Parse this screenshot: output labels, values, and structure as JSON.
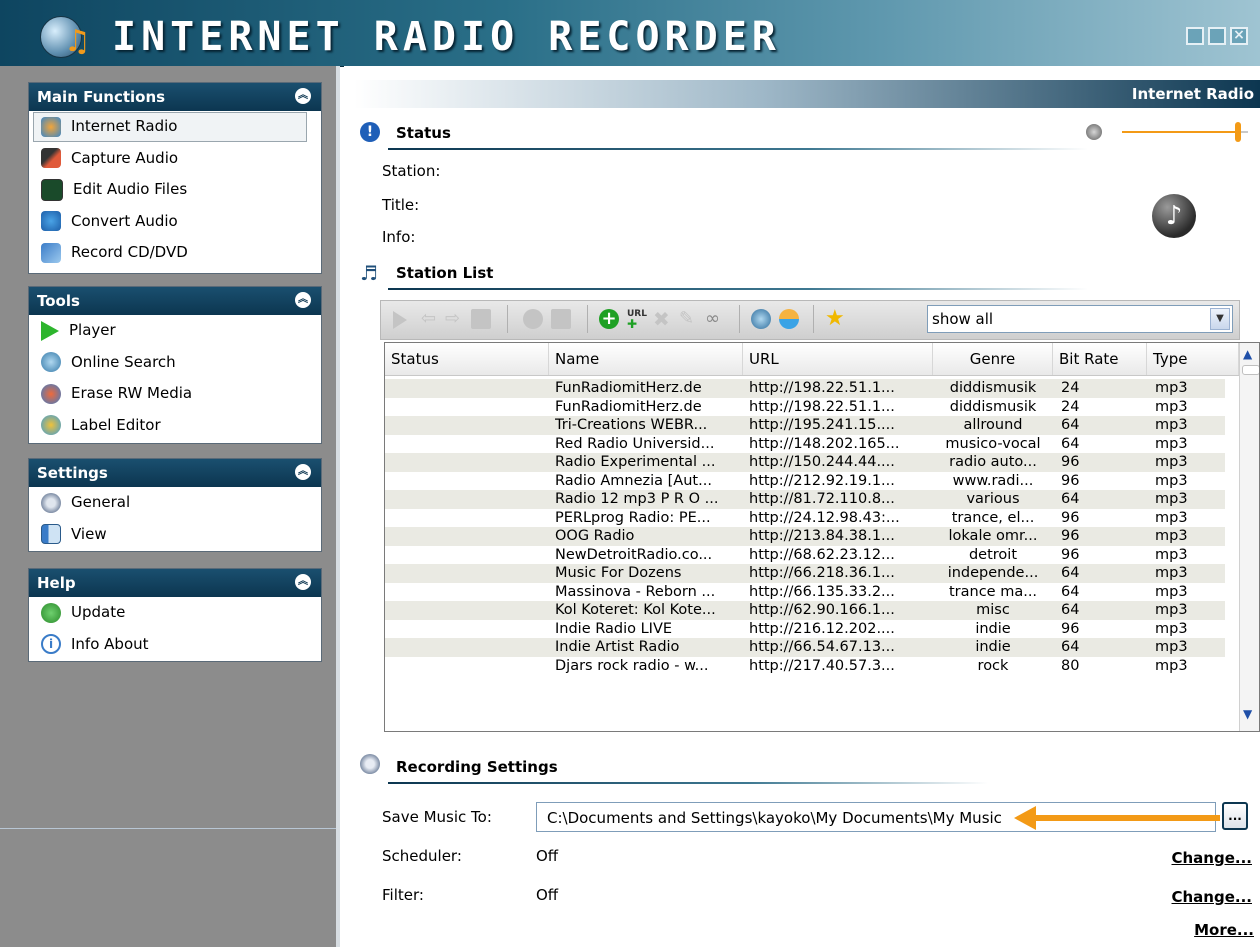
{
  "app": {
    "title": "INTERNET RADIO RECORDER"
  },
  "sidebar": {
    "main_functions": {
      "title": "Main Functions",
      "items": [
        {
          "label": "Internet Radio",
          "icon": "globe-note-icon",
          "active": true
        },
        {
          "label": "Capture Audio",
          "icon": "microphone-icon"
        },
        {
          "label": "Edit Audio Files",
          "icon": "waveform-icon"
        },
        {
          "label": "Convert Audio",
          "icon": "convert-note-icon"
        },
        {
          "label": "Record CD/DVD",
          "icon": "disc-burn-icon"
        }
      ]
    },
    "tools": {
      "title": "Tools",
      "items": [
        {
          "label": "Player",
          "icon": "play-icon"
        },
        {
          "label": "Online Search",
          "icon": "online-search-icon"
        },
        {
          "label": "Erase RW Media",
          "icon": "erase-disc-icon"
        },
        {
          "label": "Label Editor",
          "icon": "label-editor-icon"
        }
      ]
    },
    "settings": {
      "title": "Settings",
      "items": [
        {
          "label": "General",
          "icon": "gear-icon"
        },
        {
          "label": "View",
          "icon": "view-icon"
        }
      ]
    },
    "help": {
      "title": "Help",
      "items": [
        {
          "label": "Update",
          "icon": "update-icon"
        },
        {
          "label": "Info About",
          "icon": "info-icon"
        }
      ]
    }
  },
  "main": {
    "header": "Internet Radio",
    "status": {
      "title": "Status",
      "station_label": "Station:",
      "title_label": "Title:",
      "info_label": "Info:",
      "volume": 0.92
    },
    "station_list": {
      "title": "Station List",
      "filter_value": "show all",
      "columns": [
        "Status",
        "Name",
        "URL",
        "Genre",
        "Bit Rate",
        "Type"
      ],
      "rows": [
        [
          "",
          "FunRadiomitHerz.de",
          "http://198.22.51.1...",
          "diddismusik",
          "24",
          "mp3"
        ],
        [
          "",
          "FunRadiomitHerz.de",
          "http://198.22.51.1...",
          "diddismusik",
          "24",
          "mp3"
        ],
        [
          "",
          "Tri-Creations WEBR...",
          "http://195.241.15....",
          "allround",
          "64",
          "mp3"
        ],
        [
          "",
          "Red Radio Universid...",
          "http://148.202.165...",
          "musico-vocal",
          "64",
          "mp3"
        ],
        [
          "",
          "Radio Experimental ...",
          "http://150.244.44....",
          "radio auto...",
          "96",
          "mp3"
        ],
        [
          "",
          "Radio Amnezia [Aut...",
          "http://212.92.19.1...",
          "www.radi...",
          "96",
          "mp3"
        ],
        [
          "",
          "Radio 12 mp3 P R O ...",
          "http://81.72.110.8...",
          "various",
          "64",
          "mp3"
        ],
        [
          "",
          "PERLprog Radio: PE...",
          "http://24.12.98.43:...",
          "trance, el...",
          "96",
          "mp3"
        ],
        [
          "",
          "OOG Radio",
          "http://213.84.38.1...",
          "lokale omr...",
          "96",
          "mp3"
        ],
        [
          "",
          "NewDetroitRadio.co...",
          "http://68.62.23.12...",
          "detroit",
          "96",
          "mp3"
        ],
        [
          "",
          "Music For Dozens",
          "http://66.218.36.1...",
          "independe...",
          "64",
          "mp3"
        ],
        [
          "",
          "Massinova - Reborn ...",
          "http://66.135.33.2...",
          "trance ma...",
          "64",
          "mp3"
        ],
        [
          "",
          "Kol Koteret: Kol Kote...",
          "http://62.90.166.1...",
          "misc",
          "64",
          "mp3"
        ],
        [
          "",
          "Indie Radio LIVE",
          "http://216.12.202....",
          "indie",
          "96",
          "mp3"
        ],
        [
          "",
          "Indie Artist Radio",
          "http://66.54.67.13...",
          "indie",
          "64",
          "mp3"
        ],
        [
          "",
          "Djars rock radio - w...",
          "http://217.40.57.3...",
          "rock",
          "80",
          "mp3"
        ]
      ]
    },
    "recording": {
      "title": "Recording Settings",
      "save_label": "Save Music To:",
      "save_path": "C:\\Documents and Settings\\kayoko\\My Documents\\My Music",
      "browse_label": "...",
      "scheduler_label": "Scheduler:",
      "scheduler_value": "Off",
      "filter_label": "Filter:",
      "filter_value": "Off",
      "change_label": "Change...",
      "more_label": "More..."
    }
  },
  "colors": {
    "titlebar": "#0e4560",
    "panel_header": "#0c3650",
    "accent_arrow": "#f39a16",
    "sidebar_bg": "#8c8c8c"
  }
}
